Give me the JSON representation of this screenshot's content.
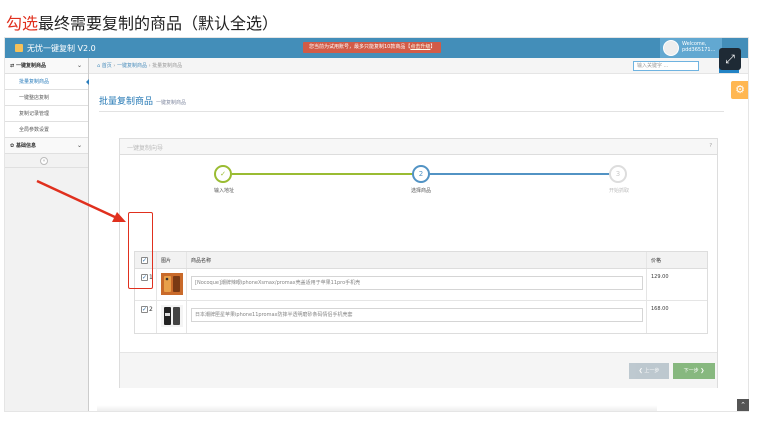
{
  "caption": {
    "highlight": "勾选",
    "rest": "最终需要复制的商品（默认全选）"
  },
  "topbar": {
    "app_name": "无忧一键复制 V2.0",
    "warning": "您当前为试用账号，最多只能复制10款商品",
    "warning_link": "点击升级",
    "welcome_line1": "Welcome,",
    "welcome_line2": "pdd365171..."
  },
  "sidebar": {
    "group1": "一键复制商品",
    "items": [
      "批量复制商品",
      "一键整店复制",
      "复制记录管理",
      "全局参数设置"
    ],
    "group2": "基础信息",
    "collapse_glyph": "«"
  },
  "breadcrumb": {
    "home": "首页",
    "sep": "›",
    "level1": "一键复制商品",
    "current": "批量复制商品"
  },
  "search": {
    "placeholder": "输入关键字 ..."
  },
  "page": {
    "title": "批量复制商品",
    "subtitle": "一键复制商品"
  },
  "wizard": {
    "title": "一键复制向导",
    "help": "?",
    "steps": [
      {
        "num": "✓",
        "label": "输入地址"
      },
      {
        "num": "2",
        "label": "选择商品"
      },
      {
        "num": "3",
        "label": "开始抓取"
      }
    ]
  },
  "table": {
    "headers": {
      "image": "图片",
      "name": "商品名称",
      "price": "价格"
    },
    "rows": [
      {
        "num": "1",
        "name": "[Nocoque]潮牌辣眼iphoneXsmax/promax壳盖适用于苹果11pro手机壳",
        "price": "129.00"
      },
      {
        "num": "2",
        "name": "日本潮牌匣星苹果iphone11promax防摔半透明磨砂条码情侣手机壳套",
        "price": "168.00"
      }
    ]
  },
  "buttons": {
    "prev": "❮ 上一步",
    "next": "下一步 ❯"
  },
  "colors": {
    "accent": "#438eb9",
    "annotation": "#e0301e",
    "next": "#87b87f"
  }
}
